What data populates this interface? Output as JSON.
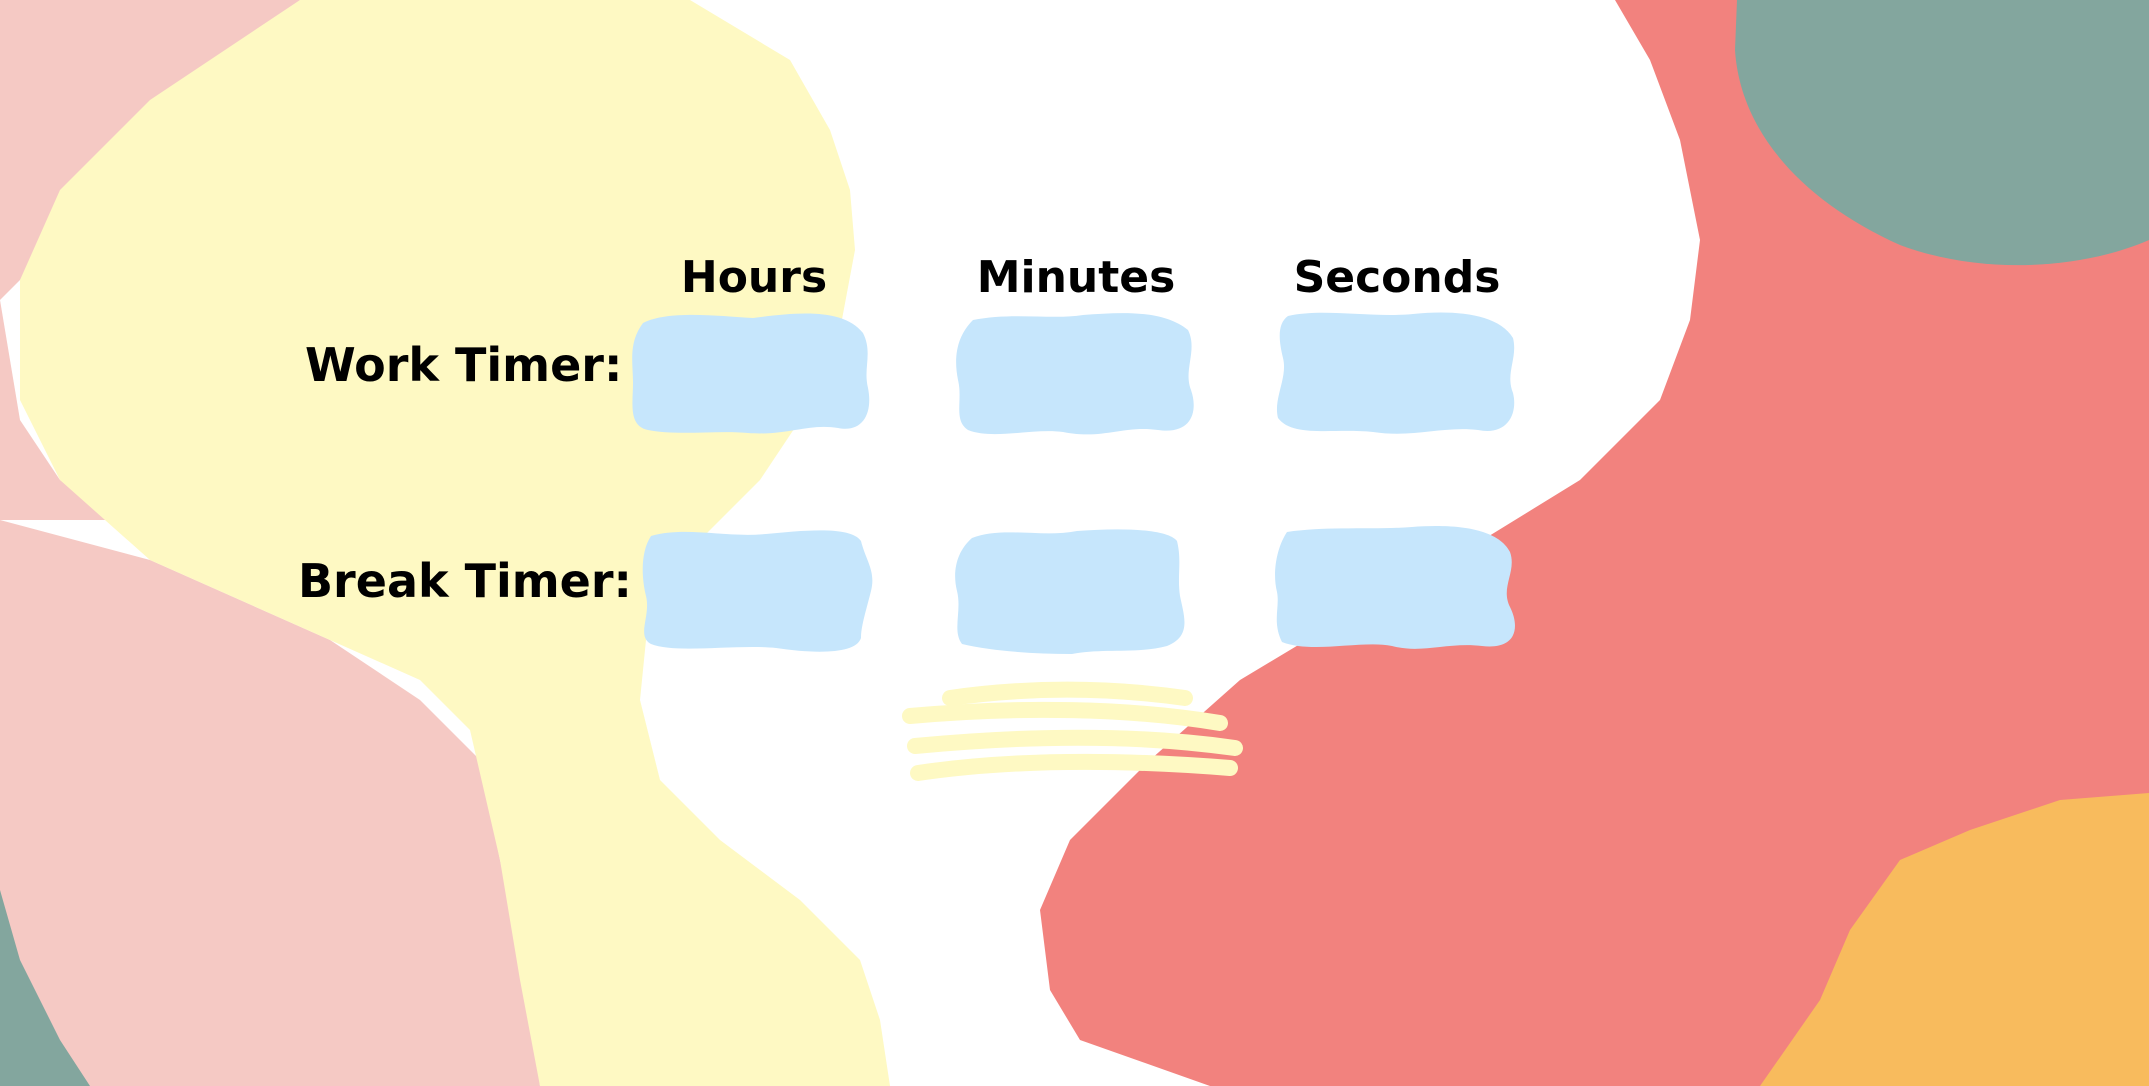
{
  "headers": {
    "hours": "Hours",
    "minutes": "Minutes",
    "seconds": "Seconds"
  },
  "rows": {
    "work_label": "Work Timer:",
    "break_label": "Break Timer:"
  },
  "inputs": {
    "work_hours": "",
    "work_minutes": "",
    "work_seconds": "",
    "break_hours": "",
    "break_minutes": "",
    "break_seconds": ""
  },
  "colors": {
    "pink": "#f5c9c4",
    "yellow": "#fef9c3",
    "coral": "#f2827e",
    "teal": "#83a69e",
    "orange": "#f8bb5d",
    "input_blue": "#c6e6fc"
  }
}
